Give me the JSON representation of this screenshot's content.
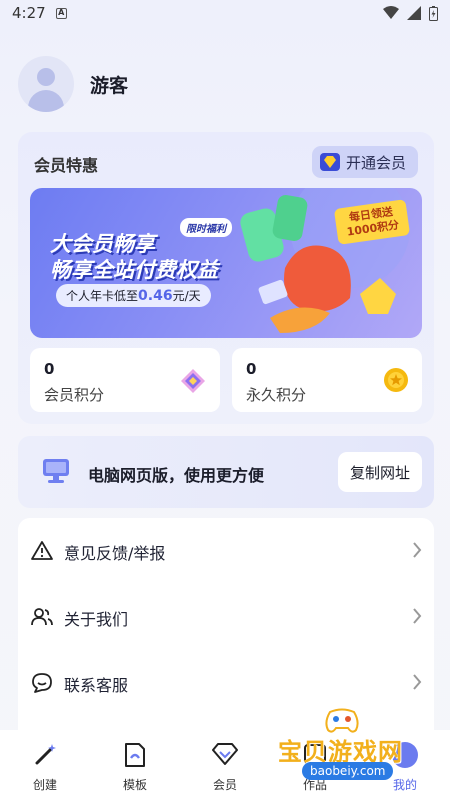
{
  "status": {
    "time": "4:27",
    "sim": "A"
  },
  "profile": {
    "name": "游客"
  },
  "member": {
    "title": "会员特惠",
    "open_label": "开通会员",
    "banner": {
      "line1": "大会员畅享",
      "line2": "畅享全站付费权益",
      "tag": "限时福利",
      "price_prefix": "个人年卡低至",
      "price_value": "0.46",
      "price_suffix": "元/天",
      "badge": "每日领送1000积分"
    },
    "points": [
      {
        "value": "0",
        "label": "会员积分",
        "icon": "vip-gem-icon"
      },
      {
        "value": "0",
        "label": "永久积分",
        "icon": "coin-icon"
      }
    ]
  },
  "web_promo": {
    "text": "电脑网页版，使用更方便",
    "button": "复制网址"
  },
  "menu": [
    {
      "label": "意见反馈/举报",
      "icon": "warning-icon"
    },
    {
      "label": "关于我们",
      "icon": "users-icon"
    },
    {
      "label": "联系客服",
      "icon": "chat-icon"
    }
  ],
  "tabs": [
    {
      "label": "创建",
      "icon": "wand-icon"
    },
    {
      "label": "模板",
      "icon": "template-icon"
    },
    {
      "label": "会员",
      "icon": "diamond-icon"
    },
    {
      "label": "作品",
      "icon": "works-icon"
    },
    {
      "label": "我的",
      "icon": "profile-icon",
      "active": true
    }
  ],
  "watermark": {
    "text": "宝贝游戏网",
    "url": "baobeiy.com"
  },
  "colors": {
    "accent": "#5566e8",
    "banner_start": "#6d7cf2",
    "coin": "#f5b90f"
  }
}
